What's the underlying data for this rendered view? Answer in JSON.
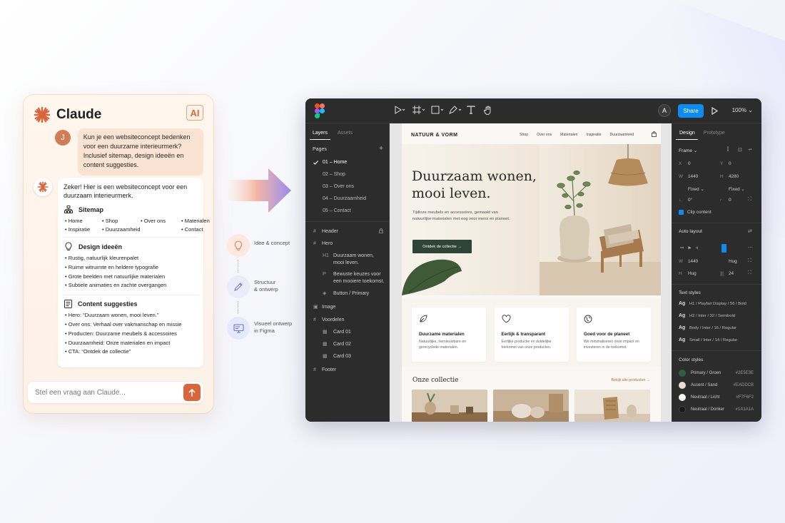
{
  "colors": {
    "accent": "#d9663b",
    "figma_blue": "#0d8cf0",
    "primary_green": "#2E5E3E",
    "accent_sand": "#EADDCB",
    "neutral_light": "#F7F6F2",
    "neutral_dark": "#1A1A1A"
  },
  "chat": {
    "title": "Claude",
    "badge": "AI",
    "user_avatar": "J",
    "user_message": "Kun je een websiteconcept bedenken voor een duurzame interieurmerk? Inclusief sitemap, design ideeën en content suggesties.",
    "bot_intro": "Zeker! Hier is een websiteconcept voor een duurzaam interieurmerk.",
    "sitemap_title": "Sitemap",
    "sitemap_items": [
      "Home",
      "Shop",
      "Over ons",
      "Materialen",
      "Inspiratie",
      "Duurzaamheid",
      "Contact"
    ],
    "design_title": "Design ideeën",
    "design_items": [
      "Rustig, natuurlijk kleurenpalet",
      "Ruime witruimte en heldere typografie",
      "Grote beelden met natuurlijke materialen",
      "Subtiele animaties en zachte overgangen"
    ],
    "content_title": "Content suggesties",
    "content_items": [
      "Hero: “Duurzaam wonen, mooi leven.”",
      "Over ons: Verhaal over vakmanschap en missie",
      "Producten: Duurzame meubels & accessoires",
      "Duurzaamheid: Onze materialen en impact",
      "CTA: “Ontdek de collectie”"
    ],
    "input_placeholder": "Stel een vraag aan Claude..."
  },
  "steps": [
    {
      "label_1": "Idee & concept",
      "label_2": "",
      "icon": "lightbulb-icon"
    },
    {
      "label_1": "Structuur",
      "label_2": "& ontwerp",
      "icon": "pencil-icon"
    },
    {
      "label_1": "Visueel ontwerp",
      "label_2": "in Figma",
      "icon": "monitor-icon"
    }
  ],
  "figma": {
    "share": "Share",
    "zoom": "100%",
    "avatar": "A",
    "left_tabs": [
      "Layers",
      "Assets"
    ],
    "pages_title": "Pages",
    "pages": [
      "01 – Home",
      "02 – Shop",
      "03 – Over ons",
      "04 – Duurzaamheid",
      "05 – Contact"
    ],
    "layers": [
      {
        "icon": "#",
        "label": "Header"
      },
      {
        "icon": "#",
        "label": "Hero"
      },
      {
        "icon": "H1",
        "label": "Duurzaam wonen,",
        "label2": "mooi leven."
      },
      {
        "icon": "P",
        "label": "Bewuste keuzes voor",
        "label2": "een mooiere toekomst."
      },
      {
        "icon": "◈",
        "label": "Button / Primary"
      },
      {
        "icon": "▣",
        "label": "Image"
      },
      {
        "icon": "#",
        "label": "Voordelen"
      },
      {
        "icon": "▦",
        "label": "Card 01"
      },
      {
        "icon": "▦",
        "label": "Card 02"
      },
      {
        "icon": "▦",
        "label": "Card 03"
      },
      {
        "icon": "#",
        "label": "Footer"
      }
    ],
    "right_tabs": [
      "Design",
      "Prototype"
    ],
    "frame_label": "Frame",
    "x_key": "X",
    "x_val": "0",
    "y_key": "Y",
    "y_val": "0",
    "w_key": "W",
    "w_val": "1440",
    "h_key": "H",
    "h_val": "4280",
    "fixed_w": "Fixed",
    "fixed_h": "Fixed",
    "rotation": "0°",
    "radius": "0",
    "clip_content": "Clip content",
    "auto_layout": "Auto layout",
    "al_w_val": "1440",
    "al_w_mode": "Hug",
    "al_h_mode": "Hug",
    "al_gap": "24",
    "text_styles_title": "Text styles",
    "text_styles": [
      "H1 / Playfair Display / 56 / Bold",
      "H2 / Inter / 32 / Semibold",
      "Body / Inter / 16 / Regular",
      "Small / Inter / 14 / Regular"
    ],
    "color_styles_title": "Color styles",
    "color_styles": [
      {
        "name": "Primary / Groen",
        "hex": "#2E5E3E"
      },
      {
        "name": "Accent / Sand",
        "hex": "#EADDCB"
      },
      {
        "name": "Neutraal / Licht",
        "hex": "#F7F6F2"
      },
      {
        "name": "Neutraal / Donker",
        "hex": "#1A1A1A"
      }
    ]
  },
  "site": {
    "brand": "NATUUR & VORM",
    "nav": [
      "Shop",
      "Over ons",
      "Materialen",
      "Inspiratie",
      "Duurzaamheid"
    ],
    "hero_title_1": "Duurzaam wonen,",
    "hero_title_2": "mooi leven.",
    "hero_text": "Tijdloze meubels en accessoires, gemaakt van natuurlijke materialen met oog voor mens en planeet.",
    "hero_button": "Ontdek de collectie →",
    "features": [
      {
        "title": "Duurzame materialen",
        "text": "Natuurlijke, hernieuwbare en gerecyclede materialen.",
        "icon": "leaf-icon"
      },
      {
        "title": "Eerlijk & transparant",
        "text": "Eerlijke productie en duidelijke herkomst van onze producten.",
        "icon": "heart-icon"
      },
      {
        "title": "Goed voor de planeet",
        "text": "We minimaliseren onze impact en investeren in de toekomst.",
        "icon": "globe-icon"
      }
    ],
    "collection_title": "Onze collectie",
    "collection_link": "Bekijk alle producten →"
  }
}
